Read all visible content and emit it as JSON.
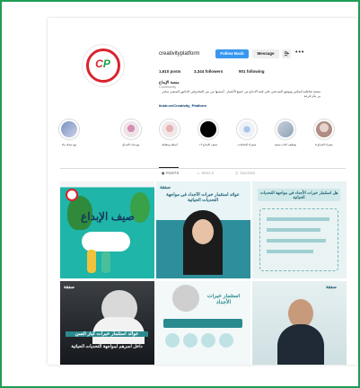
{
  "profile": {
    "username": "creativityplatform",
    "logo_text_a": "C",
    "logo_text_b": "P",
    "follow_label": "Follow Back",
    "message_label": "Message",
    "suggest_icon": "add-user-icon",
    "more_icon": "more-icon",
    "posts": "1,610 posts",
    "followers": "3,344 followers",
    "following": "901 following",
    "name": "منصة الإبداع",
    "category": "Community",
    "bio": "منصة تفاعلية لتمكين وتوثيق المبدعين على قمة الابداع من جميع الأعمار . أسسها من بين المحترفين الدكتور المتميز سامر بن بكر قرعة",
    "link": "linktr.ee/Creativity_Platform"
  },
  "highlights": [
    {
      "label": "سفراء الإبداع ٥",
      "color": "#c9a9a0"
    },
    {
      "label": "توظيف كتاب سعيد",
      "color": "#b9c4d1"
    },
    {
      "label": "سفراء الإنتاجات",
      "color": "#dfe3ea"
    },
    {
      "label": "ضيف الإبداع ١٣",
      "color": "#000000"
    },
    {
      "label": "أسئلة ومقابلة",
      "color": "#c9a2a5"
    },
    {
      "label": "مع ثبات الإبداع",
      "color": "#d7bccb"
    },
    {
      "label": "مع سمك ماء",
      "color": "#99a9c6"
    }
  ],
  "tabs": {
    "posts": "POSTS",
    "reels": "REELS",
    "tagged": "TAGGED"
  },
  "grid_posts": [
    {
      "title": "صيف الإبداع",
      "caption": ""
    },
    {
      "title": "صفقة",
      "caption": "عوائد استثمار خبرات الأجداد في مواجهة التحديات الحياتية"
    },
    {
      "title": "",
      "caption": "هل استثمار خبرات الأجداد في مواجهة التحديات الحياتية"
    },
    {
      "title": "صفقة",
      "caption": "عوائد استثمار خبرات كبار السن"
    },
    {
      "title": "",
      "caption": "داخل اسرهم لمواجهة التحديات الحياتية"
    },
    {
      "title": "استثمار خبرات الأجداد",
      "caption": ""
    },
    {
      "title": "صفقة",
      "caption": ""
    }
  ],
  "colors": {
    "brand_blue": "#3897f0",
    "logo_red": "#d9232d",
    "logo_green": "#1aa14a",
    "frame_green": "#1f9d55"
  }
}
